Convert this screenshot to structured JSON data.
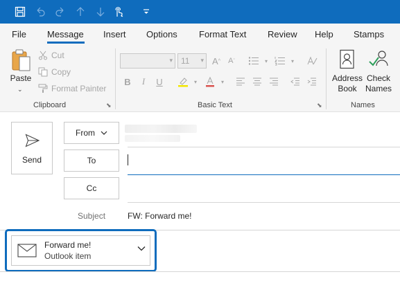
{
  "quick_access": {
    "icons": [
      "save-icon",
      "undo-icon",
      "redo-icon",
      "up-arrow-icon",
      "down-arrow-icon",
      "touch-mode-icon",
      "customize-icon"
    ]
  },
  "tabs": [
    {
      "label": "File"
    },
    {
      "label": "Message"
    },
    {
      "label": "Insert"
    },
    {
      "label": "Options"
    },
    {
      "label": "Format Text"
    },
    {
      "label": "Review"
    },
    {
      "label": "Help"
    },
    {
      "label": "Stamps"
    }
  ],
  "active_tab": "Message",
  "ribbon": {
    "clipboard": {
      "paste": "Paste",
      "cut": "Cut",
      "copy": "Copy",
      "format_painter": "Format Painter",
      "group_label": "Clipboard"
    },
    "basic_text": {
      "font_size": "11",
      "group_label": "Basic Text"
    },
    "names": {
      "address_book_line1": "Address",
      "address_book_line2": "Book",
      "check_names_line1": "Check",
      "check_names_line2": "Names",
      "group_label": "Names"
    }
  },
  "compose": {
    "send_label": "Send",
    "from_label": "From",
    "to_label": "To",
    "cc_label": "Cc",
    "subject_label": "Subject",
    "subject_value": "FW: Forward me!"
  },
  "attachment": {
    "name": "Forward me!",
    "type": "Outlook item"
  },
  "colors": {
    "accent": "#0f6cbd",
    "ribbon_bg": "#f5f5f5"
  }
}
